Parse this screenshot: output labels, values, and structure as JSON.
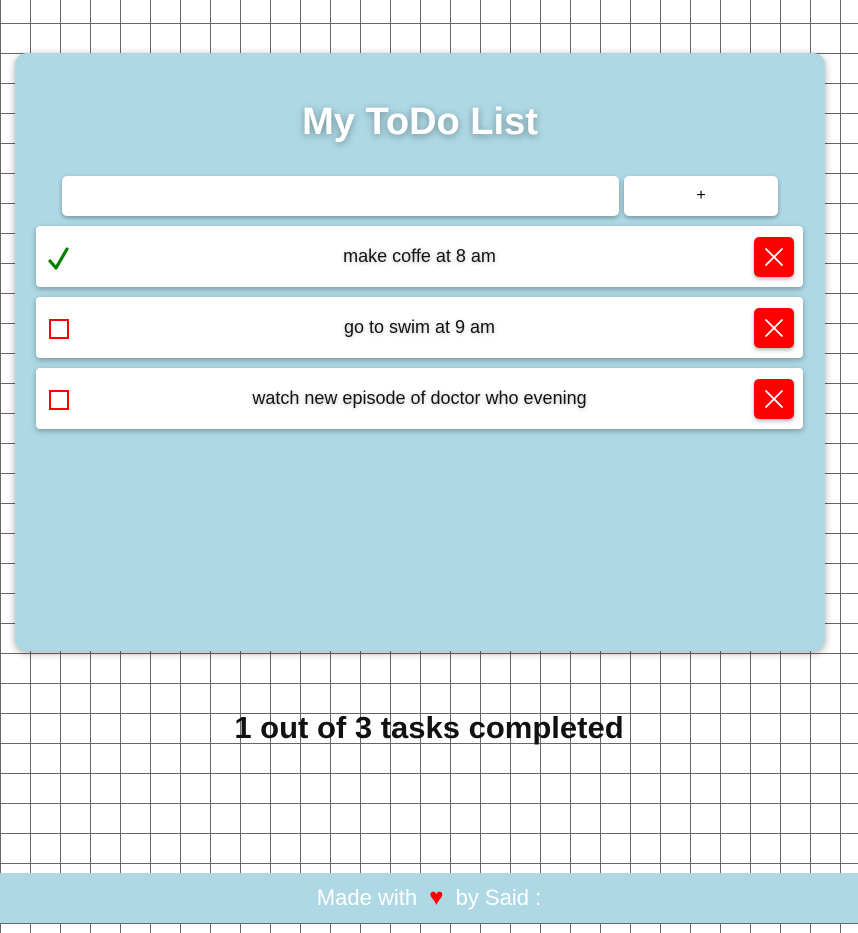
{
  "app": {
    "title": "My ToDo List"
  },
  "input": {
    "value": "",
    "placeholder": ""
  },
  "add_button": {
    "label": "+"
  },
  "tasks": [
    {
      "text": "make coffe at 8 am",
      "completed": true
    },
    {
      "text": "go to swim at 9 am",
      "completed": false
    },
    {
      "text": "watch new episode of doctor who evening",
      "completed": false
    }
  ],
  "summary": {
    "text": "1 out of 3 tasks completed"
  },
  "footer": {
    "prefix": "Made with",
    "heart_icon": "♥",
    "suffix": "by Said :"
  },
  "icons": {
    "checked": "checkmark-icon",
    "unchecked": "empty-checkbox-icon",
    "delete": "close-icon"
  },
  "colors": {
    "card_background": "#add8e4",
    "delete_button": "#ff0000",
    "check_mark": "#008000",
    "unchecked_border": "#ff0000",
    "heart": "#ff0000"
  }
}
